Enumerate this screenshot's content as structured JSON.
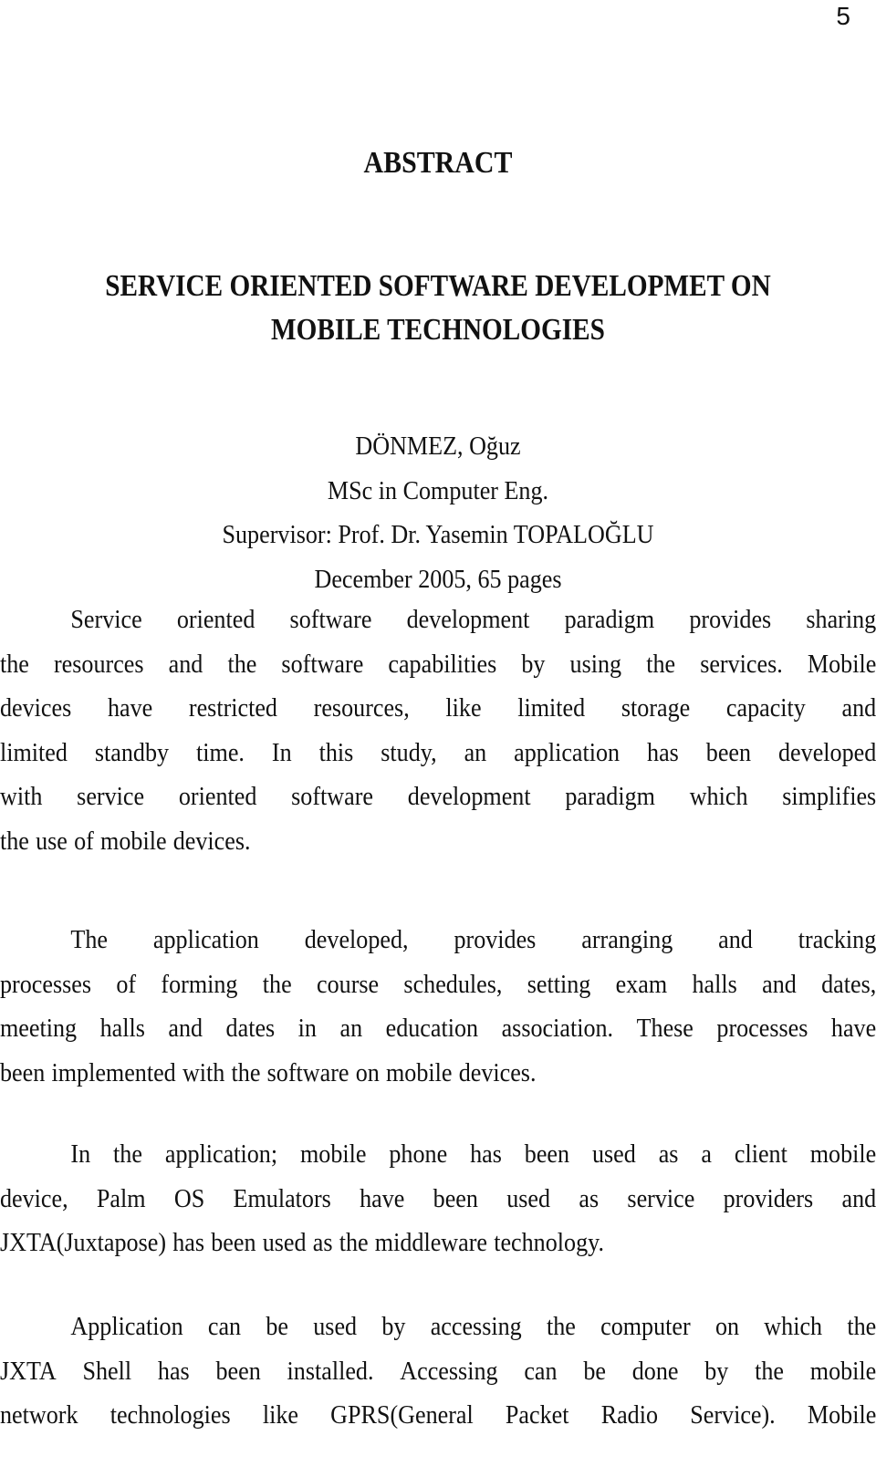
{
  "page_number": "5",
  "abstract_heading": "ABSTRACT",
  "thesis_title": {
    "line1": "SERVICE ORIENTED SOFTWARE DEVELOPMET ON",
    "line2": "MOBILE TECHNOLOGIES"
  },
  "meta": {
    "author": "DÖNMEZ, Oğuz",
    "degree": "MSc in Computer Eng.",
    "supervisor": "Supervisor: Prof. Dr. Yasemin TOPALOĞLU",
    "date_pages": "December 2005, 65 pages"
  },
  "paragraphs": [
    {
      "lines": [
        "Service oriented software development paradigm provides sharing",
        "the resources and the software capabilities by using the services. Mobile",
        "devices have restricted resources, like limited storage capacity and",
        "limited standby time. In this study, an application has been developed",
        "with service oriented software development paradigm which simplifies",
        "the use of mobile devices."
      ]
    },
    {
      "lines": [
        "The application developed, provides arranging and tracking",
        "processes of forming the course schedules, setting exam halls and dates,",
        "meeting halls and dates in an education association. These processes have",
        "been  implemented with the software on mobile devices."
      ]
    },
    {
      "lines": [
        "In the application; mobile phone has been used as a client mobile",
        "device, Palm OS Emulators have been used as service providers and",
        "JXTA(Juxtapose) has been used as the middleware technology."
      ]
    },
    {
      "lines": [
        "Application can be used by accessing the computer on which the",
        "JXTA Shell has been installed. Accessing can be done by the mobile",
        "network technologies like GPRS(General Packet Radio Service). Mobile"
      ]
    }
  ]
}
